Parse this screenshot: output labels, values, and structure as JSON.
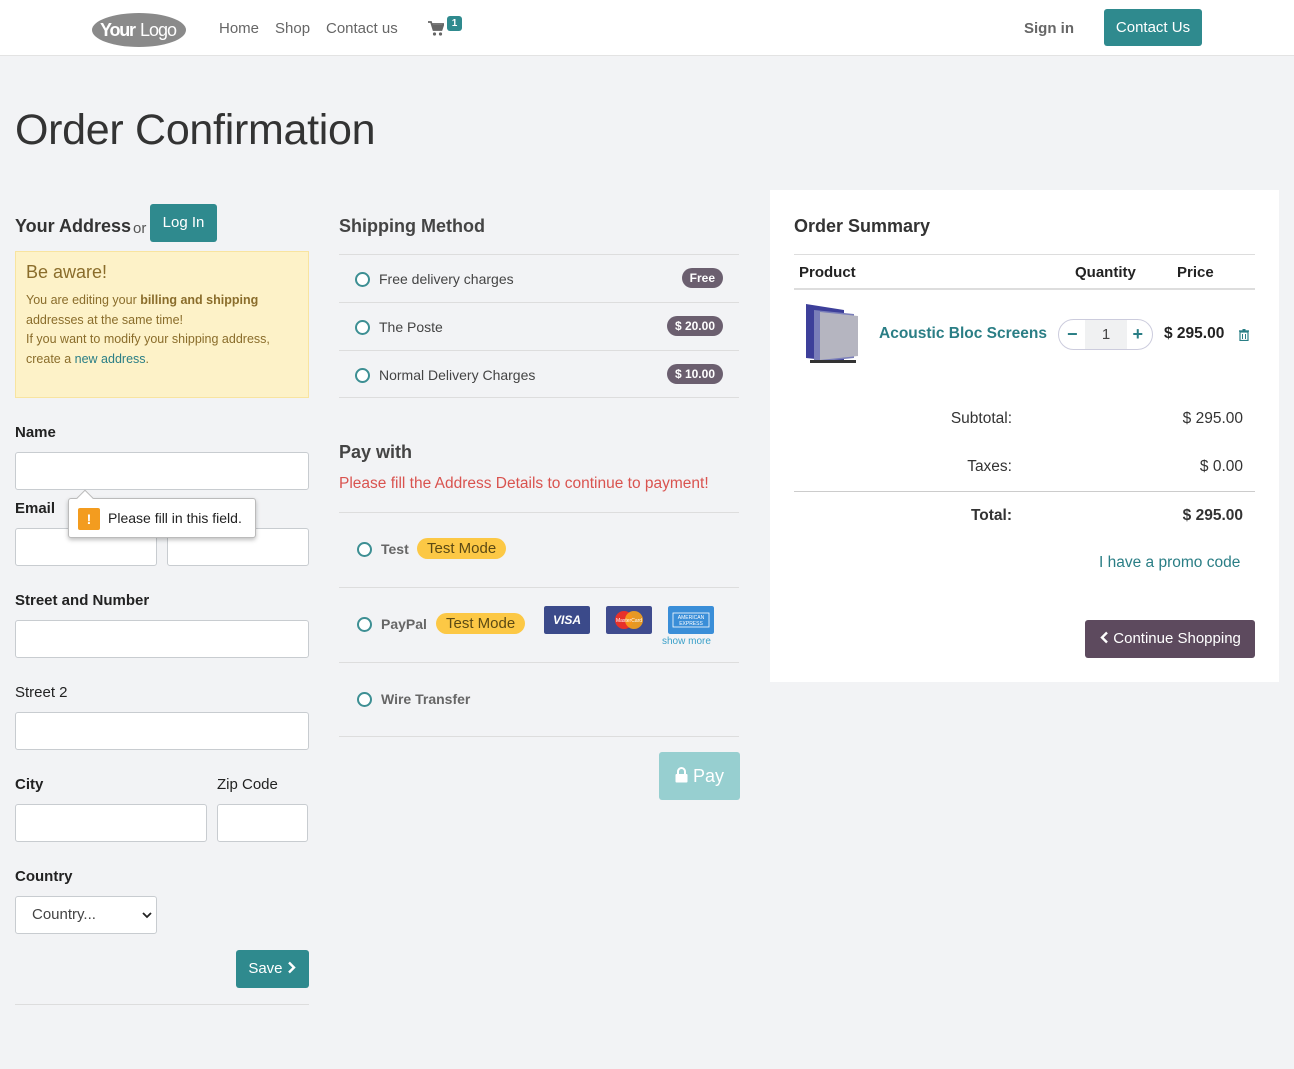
{
  "header": {
    "logo_text": "YourLogo",
    "nav": [
      "Home",
      "Shop",
      "Contact us"
    ],
    "cart_count": "1",
    "sign_in": "Sign in",
    "contact_button": "Contact Us"
  },
  "page_title": "Order Confirmation",
  "address": {
    "title": "Your Address",
    "or": "or",
    "login_button": "Log In",
    "alert_title": "Be aware!",
    "alert_line1_pre": "You are editing your ",
    "alert_line1_bold": "billing and shipping",
    "alert_line1_post": " addresses at the same time!",
    "alert_line2_pre": "If you want to modify your shipping address, create a ",
    "alert_line2_link": "new address",
    "alert_line2_post": ".",
    "name_label": "Name",
    "email_label": "Email",
    "street_label": "Street and Number",
    "street2_label": "Street 2",
    "city_label": "City",
    "zip_label": "Zip Code",
    "country_label": "Country",
    "country_value": "Country...",
    "tooltip": "Please fill in this field.",
    "save_button": "Save"
  },
  "shipping": {
    "title": "Shipping Method",
    "methods": [
      {
        "label": "Free delivery charges",
        "badge": "Free"
      },
      {
        "label": "The Poste",
        "badge": "$ 20.00"
      },
      {
        "label": "Normal Delivery Charges",
        "badge": "$ 10.00"
      }
    ]
  },
  "payment": {
    "title": "Pay with",
    "warning": "Please fill the Address Details to continue to payment!",
    "methods": [
      {
        "label": "Test",
        "badge": "Test Mode"
      },
      {
        "label": "PayPal",
        "badge": "Test Mode"
      },
      {
        "label": "Wire Transfer"
      }
    ],
    "cards": [
      "VISA",
      "MasterCard",
      "AMERICAN EXPRESS"
    ],
    "show_more": "show more",
    "pay_button": "Pay"
  },
  "summary": {
    "title": "Order Summary",
    "columns": [
      "Product",
      "Quantity",
      "Price"
    ],
    "product": {
      "name": "Acoustic Bloc Screens",
      "quantity": "1",
      "price": "$ 295.00"
    },
    "subtotal_label": "Subtotal:",
    "subtotal": "$ 295.00",
    "taxes_label": "Taxes:",
    "taxes": "$ 0.00",
    "total_label": "Total:",
    "total": "$ 295.00",
    "promo": "I have a promo code",
    "continue_button": "Continue Shopping"
  },
  "colors": {
    "primary": "#2f8a8e",
    "secondary": "#5d4a5e",
    "warning_text": "#d9534f",
    "test_mode": "#fcc845"
  }
}
